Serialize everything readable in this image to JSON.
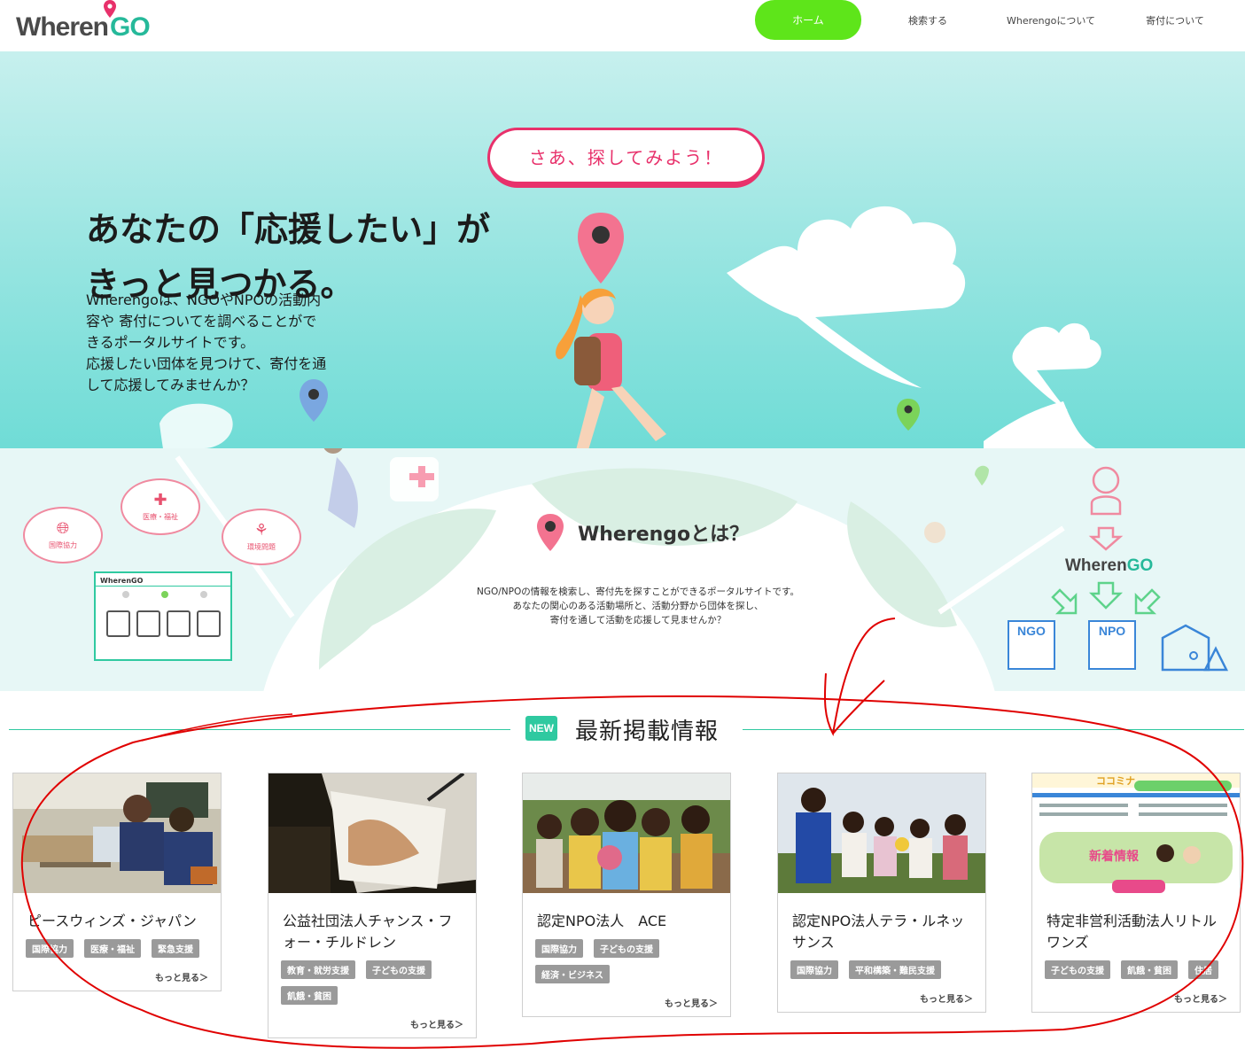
{
  "header": {
    "logo_main": "Wheren",
    "logo_go": "GO",
    "nav": [
      {
        "label": "ホーム"
      },
      {
        "label": "検索する"
      },
      {
        "label": "Wherengoについて"
      },
      {
        "label": "寄付について"
      }
    ]
  },
  "hero": {
    "cta_label": "さあ、探してみよう！",
    "headline": [
      "あなたの「応援したい」が",
      "きっと見つかる。"
    ],
    "intro": [
      "Wherengoは、NGOやNPOの活動内",
      "容や 寄付についてを調べることがで",
      "きるポータルサイトです。",
      "応援したい団体を見つけて、寄付を通",
      "して応援してみませんか？"
    ]
  },
  "about": {
    "title": "Wherengoとは？",
    "text": [
      "NGO/NPOの情報を検索し、寄付先を探すことができるポータルサイトです。",
      "あなたの関心のある活動場所と、活動分野から団体を探し、",
      "寄付を通して活動を応援して見ませんか？"
    ],
    "bubbles": [
      "国際協力",
      "医療・福祉",
      "環境問題"
    ],
    "mock_logo": "WherenGO",
    "flow_logo_main": "Wheren",
    "flow_logo_go": "GO",
    "org_labels": [
      "NGO",
      "NPO"
    ]
  },
  "news": {
    "badge": "NEW",
    "title": "最新掲載情報",
    "more_label": "もっと見る＞",
    "cards": [
      {
        "name": [
          "ピースウィンズ・ジャパン"
        ],
        "tags": [
          "国際協力",
          "医療・福祉",
          "緊急支援"
        ]
      },
      {
        "name": [
          "公益社団法人チャンス・フ",
          "ォー・チルドレン"
        ],
        "tags": [
          "教育・就労支援",
          "子どもの支援",
          "飢餓・貧困"
        ]
      },
      {
        "name": [
          "認定NPO法人　ACE"
        ],
        "tags": [
          "国際協力",
          "子どもの支援",
          "経済・ビジネス"
        ]
      },
      {
        "name": [
          "認定NPO法人テラ・ルネッ",
          "サンス"
        ],
        "tags": [
          "国際協力",
          "平和構築・難民支援"
        ]
      },
      {
        "name": [
          "特定非営利活動法人リトル",
          "ワンズ"
        ],
        "tags": [
          "子どもの支援",
          "飢餓・貧困",
          "住居"
        ]
      }
    ],
    "thumb5_banner": "ココミナ",
    "thumb5_headline": "新着情報"
  },
  "colors": {
    "accent_green": "#5ee51a",
    "teal": "#2fc9a0",
    "pink": "#e8316b",
    "annotation_red": "#e00000"
  }
}
